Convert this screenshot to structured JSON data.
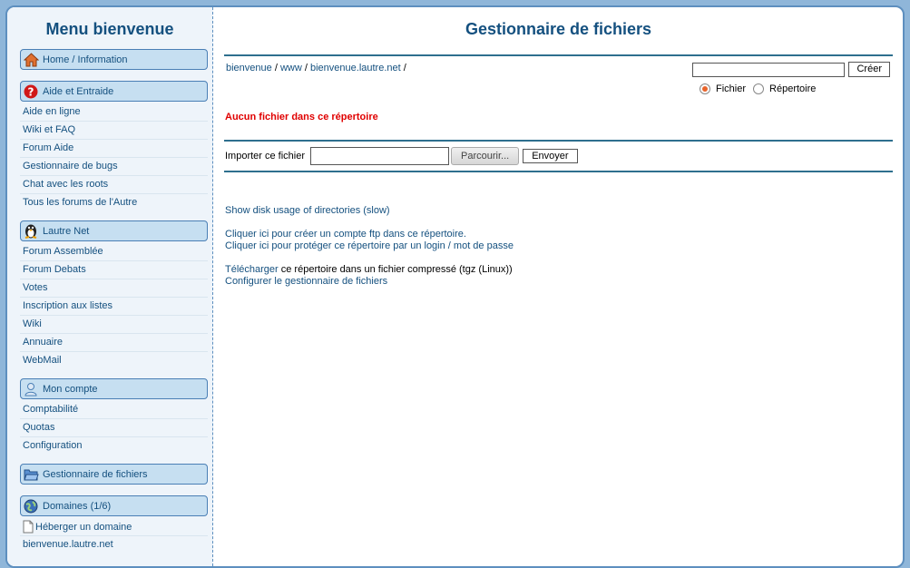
{
  "sidebar": {
    "title": "Menu bienvenue",
    "sections": [
      {
        "header": "Home / Information",
        "icon": "home-icon",
        "items": []
      },
      {
        "header": "Aide et Entraide",
        "icon": "help-icon",
        "items": [
          "Aide en ligne",
          "Wiki et FAQ",
          "Forum Aide",
          "Gestionnaire de bugs",
          "Chat avec les roots",
          "Tous les forums de l'Autre"
        ]
      },
      {
        "header": "Lautre Net",
        "icon": "penguin-icon",
        "items": [
          "Forum Assemblée",
          "Forum Debats",
          "Votes",
          "Inscription aux listes",
          "Wiki",
          "Annuaire",
          "WebMail"
        ]
      },
      {
        "header": "Mon compte",
        "icon": "user-icon",
        "items": [
          "Comptabilité",
          "Quotas",
          "Configuration"
        ]
      },
      {
        "header": "Gestionnaire de fichiers",
        "icon": "folder-icon",
        "items": []
      },
      {
        "header": "Domaines (1/6)",
        "icon": "globe-icon",
        "items": [
          "Héberger un domaine",
          "bienvenue.lautre.net"
        ]
      }
    ]
  },
  "main": {
    "title": "Gestionnaire de fichiers",
    "breadcrumb": [
      "bienvenue",
      "www",
      "bienvenue.lautre.net"
    ],
    "breadcrumb_sep": "/",
    "create_button": "Créer",
    "create_value": "",
    "radio_file": "Fichier",
    "radio_dir": "Répertoire",
    "radio_selected": "file",
    "empty_message": "Aucun fichier dans ce répertoire",
    "import_label": "Importer ce fichier",
    "browse_button": "Parcourir...",
    "send_button": "Envoyer",
    "disk_usage_link": "Show disk usage of directories (slow)",
    "ftp_link": "Cliquer ici pour créer un compte ftp dans ce répertoire.",
    "protect_link": "Cliquer ici pour protéger ce répertoire par un login / mot de passe",
    "download_link": "Télécharger",
    "download_text": " ce répertoire dans un fichier compressé (tgz (Linux))",
    "configure_link": "Configurer le gestionnaire de fichiers"
  },
  "colors": {
    "background": "#8fb6d9",
    "accent": "#14507f",
    "error": "#e00000",
    "section_header": "#c6dff1"
  }
}
